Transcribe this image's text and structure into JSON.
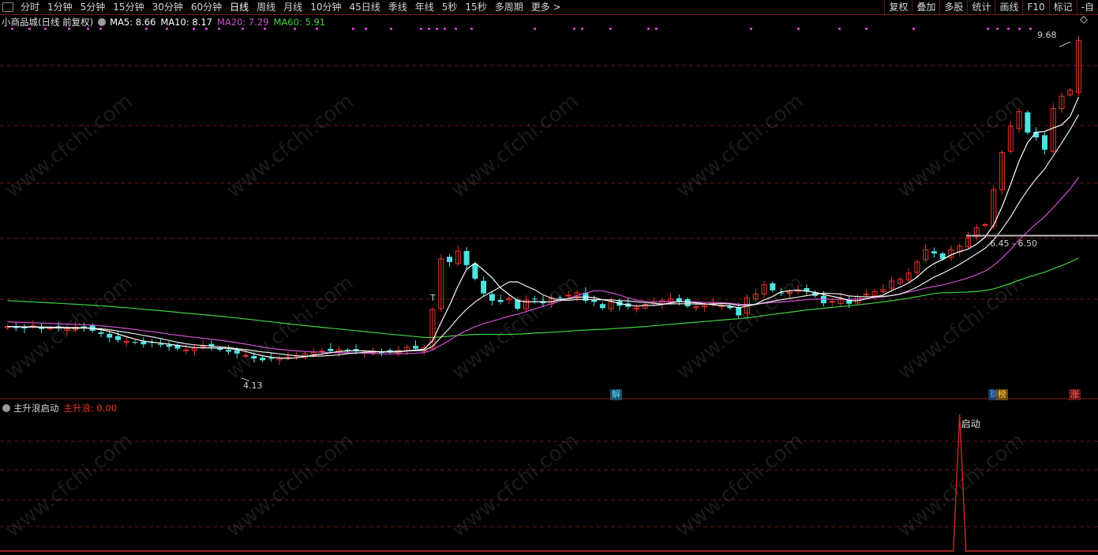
{
  "toolbar": {
    "periods": [
      "分时",
      "1分钟",
      "5分钟",
      "15分钟",
      "30分钟",
      "60分钟",
      "日线",
      "周线",
      "月线",
      "10分钟",
      "45日线",
      "季线",
      "年线",
      "5秒",
      "15秒",
      "多周期",
      "更多 >"
    ],
    "active_period": "日线",
    "right_buttons": [
      "复权",
      "叠加",
      "多股",
      "统计",
      "画线",
      "F10",
      "标记",
      "-自"
    ]
  },
  "kline_header": {
    "title": "小商品城(日线 前复权)",
    "ma": [
      {
        "label": "MA5: 8.66",
        "color": "#ffffff"
      },
      {
        "label": "MA10: 8.17",
        "color": "#ffffff"
      },
      {
        "label": "MA20: 7.29",
        "color": "#d050d0"
      },
      {
        "label": "MA60: 5.91",
        "color": "#3fd03f"
      }
    ]
  },
  "price_labels": {
    "high": "9.68",
    "low": "4.13",
    "range": "6.45 - 6.50",
    "t_marker": "T"
  },
  "event_tags": [
    {
      "text": "解",
      "bg": "#1a4f66",
      "color": "#59d6ff"
    },
    {
      "text": "财",
      "bg": "#1a3a66",
      "color": "#59b0ff"
    },
    {
      "text": "榜",
      "bg": "#6b4a10",
      "color": "#ffcc40"
    },
    {
      "text": "涨",
      "bg": "#6b1414",
      "color": "#ff6a5a"
    }
  ],
  "indicator": {
    "name": "主升浪启动",
    "value_label": "主升浪: 0.00",
    "signal_text": "启动"
  },
  "watermark": "www.cfchi.com",
  "colors": {
    "up": "#e8332a",
    "down": "#4fe3e0",
    "ma5": "#ffffff",
    "ma20": "#d050d0",
    "ma60": "#3fd03f",
    "grid": "#6a1818",
    "dots": "#c040c0"
  },
  "chart_data": {
    "type": "candlestick",
    "symbol": "小商品城",
    "period": "日线 前复权",
    "price_high": 9.68,
    "price_low": 4.13,
    "range_marker": [
      6.45,
      6.5
    ],
    "ma_latest": {
      "MA5": 8.66,
      "MA10": 8.17,
      "MA20": 7.29,
      "MA60": 5.91
    },
    "close": [
      5.02,
      5.0,
      4.99,
      5.03,
      4.98,
      5.0,
      4.99,
      4.98,
      5.01,
      5.0,
      4.95,
      4.9,
      4.84,
      4.8,
      4.78,
      4.76,
      4.73,
      4.76,
      4.72,
      4.69,
      4.66,
      4.64,
      4.67,
      4.7,
      4.69,
      4.64,
      4.61,
      4.58,
      4.55,
      4.5,
      4.47,
      4.5,
      4.51,
      4.52,
      4.55,
      4.58,
      4.6,
      4.62,
      4.62,
      4.64,
      4.63,
      4.62,
      4.6,
      4.59,
      4.6,
      4.61,
      4.63,
      4.68,
      4.66,
      4.67,
      5.3,
      6.12,
      6.07,
      6.25,
      6.02,
      5.8,
      5.56,
      5.44,
      5.42,
      5.48,
      5.31,
      5.45,
      5.47,
      5.4,
      5.48,
      5.49,
      5.53,
      5.57,
      5.44,
      5.42,
      5.32,
      5.42,
      5.36,
      5.34,
      5.32,
      5.38,
      5.42,
      5.44,
      5.47,
      5.43,
      5.35,
      5.34,
      5.36,
      5.39,
      5.36,
      5.32,
      5.2,
      5.49,
      5.55,
      5.7,
      5.61,
      5.57,
      5.58,
      5.61,
      5.6,
      5.52,
      5.4,
      5.43,
      5.47,
      5.39,
      5.51,
      5.55,
      5.59,
      5.62,
      5.76,
      5.79,
      5.89,
      6.07,
      6.27,
      6.21,
      6.12,
      6.27,
      6.33,
      6.47,
      6.63,
      6.68,
      7.25,
      7.85,
      8.28,
      8.52,
      8.18,
      8.1,
      7.9,
      8.57,
      8.77,
      8.87,
      9.68
    ],
    "indicator_signal": {
      "name": "主升浪",
      "latest": 0.0,
      "spike_at_bar": 112,
      "spike_value": 1,
      "spike_label": "启动"
    }
  }
}
